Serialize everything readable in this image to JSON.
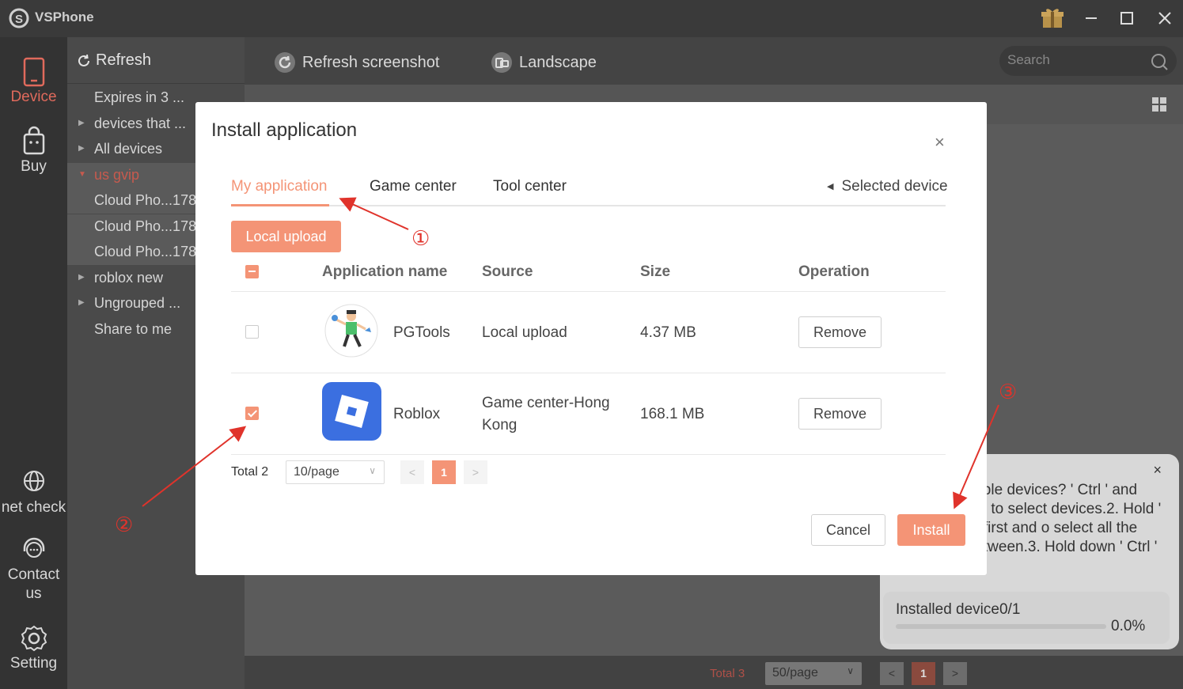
{
  "app": {
    "name": "VSPhone"
  },
  "leftnav": [
    {
      "label": "Device",
      "icon": "phone-icon",
      "active": true
    },
    {
      "label": "Buy",
      "icon": "shopping-bag-icon"
    },
    {
      "label": "net check",
      "icon": "globe-icon"
    },
    {
      "label": "Contact us",
      "icon": "headset-icon"
    },
    {
      "label": "Setting",
      "icon": "gear-icon"
    }
  ],
  "groups": {
    "refresh_label": "Refresh",
    "items": [
      {
        "label": "Expires in 3 ..."
      },
      {
        "label": "devices that ..."
      },
      {
        "label": "All devices"
      },
      {
        "label": "us gvip"
      },
      {
        "label": "Cloud Pho...178"
      },
      {
        "label": "Cloud Pho...178"
      },
      {
        "label": "Cloud Pho...178"
      },
      {
        "label": "roblox new"
      },
      {
        "label": "Ungrouped ..."
      },
      {
        "label": "Share to me"
      }
    ]
  },
  "toolbar": {
    "refresh_screenshot": "Refresh screenshot",
    "landscape": "Landscape",
    "search_placeholder": "Search"
  },
  "footer": {
    "total": "Total 3",
    "per_page": "50/page",
    "prev": "<",
    "page": "1",
    "next": ">"
  },
  "tip": {
    "text": "y select multiple devices? ' Ctrl ' and click the left n to select devices.2. Hold ' and click the first and o select all the devices in between.3. Hold down ' Ctrl ' and",
    "installed": "Installed device0/1",
    "progress_pct": "0.0%",
    "progress": 0.0,
    "close": "×"
  },
  "modal": {
    "title": "Install application",
    "close": "×",
    "tabs": [
      "My application",
      "Game center",
      "Tool center"
    ],
    "active_tab": "My application",
    "selected_device": "Selected device",
    "local_upload": "Local upload",
    "columns": [
      "Application name",
      "Source",
      "Size",
      "Operation"
    ],
    "rows": [
      {
        "name": "PGTools",
        "source": "Local upload",
        "size": "4.37 MB",
        "action": "Remove",
        "checked": false
      },
      {
        "name": "Roblox",
        "source_line1": "Game center-Hong",
        "source_line2": "Kong",
        "size": "168.1 MB",
        "action": "Remove",
        "checked": true
      }
    ],
    "pagination": {
      "total": "Total 2",
      "per_page": "10/page",
      "prev": "<",
      "page": "1",
      "next": ">"
    },
    "cancel": "Cancel",
    "install": "Install"
  },
  "annotations": [
    "①",
    "②",
    "③"
  ],
  "colors": {
    "accent": "#f49476",
    "annotation": "#e0332b",
    "active_nav": "#e06a5c"
  }
}
